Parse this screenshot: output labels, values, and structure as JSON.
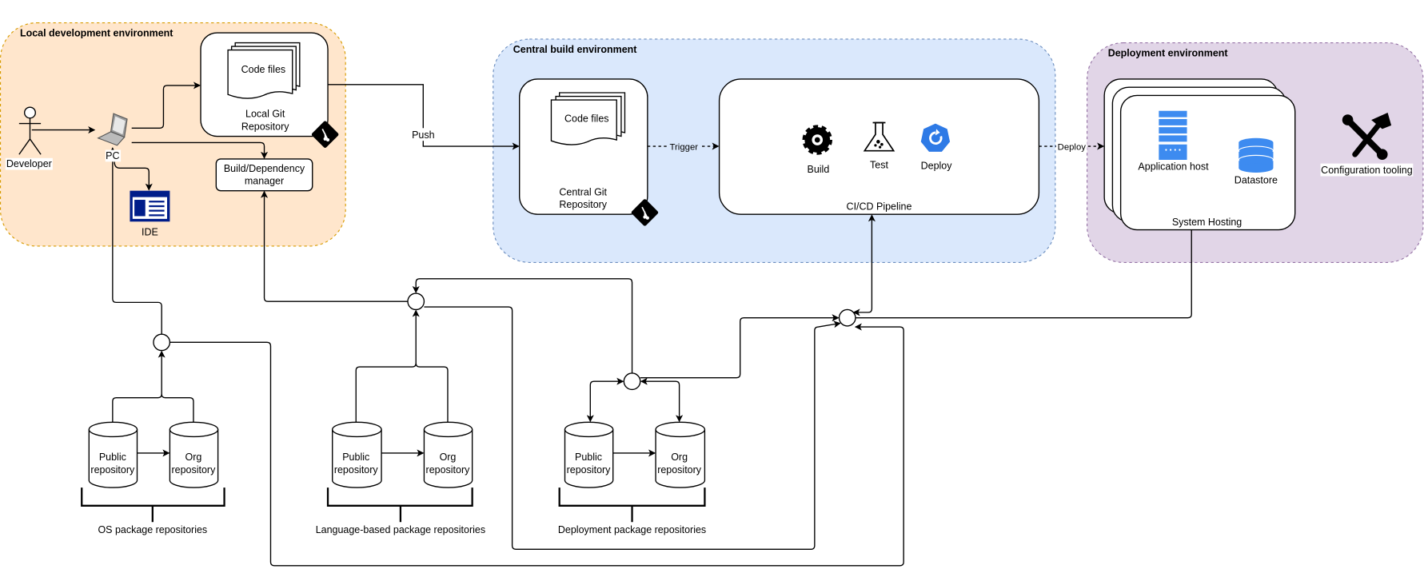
{
  "environments": {
    "local": {
      "title": "Local development environment",
      "fill": "#ffe6cc",
      "stroke": "#d79b00"
    },
    "central": {
      "title": "Central build environment",
      "fill": "#dae8fc",
      "stroke": "#6c8ebf"
    },
    "deployment": {
      "title": "Deployment environment",
      "fill": "#e1d5e7",
      "stroke": "#9673a6"
    }
  },
  "local": {
    "developer": "Developer",
    "pc": "PC",
    "code_files": "Code files",
    "git_repo_line1": "Local Git",
    "git_repo_line2": "Repository",
    "build_manager_line1": "Build/Dependency",
    "build_manager_line2": "manager",
    "ide": "IDE"
  },
  "edges": {
    "push": "Push",
    "trigger": "Trigger",
    "deploy": "Deploy"
  },
  "central": {
    "code_files": "Code files",
    "git_repo_line1": "Central Git",
    "git_repo_line2": "Repository",
    "pipeline": "CI/CD Pipeline",
    "stages": [
      "Build",
      "Test",
      "Deploy"
    ]
  },
  "deployment": {
    "app_host": "Application host",
    "datastore": "Datastore",
    "system_hosting": "System Hosting",
    "config_tooling": "Configuration tooling"
  },
  "repo_groups": [
    {
      "label": "OS package repositories",
      "public_1": "Public",
      "public_2": "repository",
      "org_1": "Org",
      "org_2": "repository"
    },
    {
      "label": "Language-based package repositories",
      "public_1": "Public",
      "public_2": "repository",
      "org_1": "Org",
      "org_2": "repository"
    },
    {
      "label": "Deployment package repositories",
      "public_1": "Public",
      "public_2": "repository",
      "org_1": "Org",
      "org_2": "repository"
    }
  ],
  "icon_colors": {
    "ide": "#001d8a",
    "deploy": "#2e7ae6",
    "server": "#3d8bf0"
  }
}
